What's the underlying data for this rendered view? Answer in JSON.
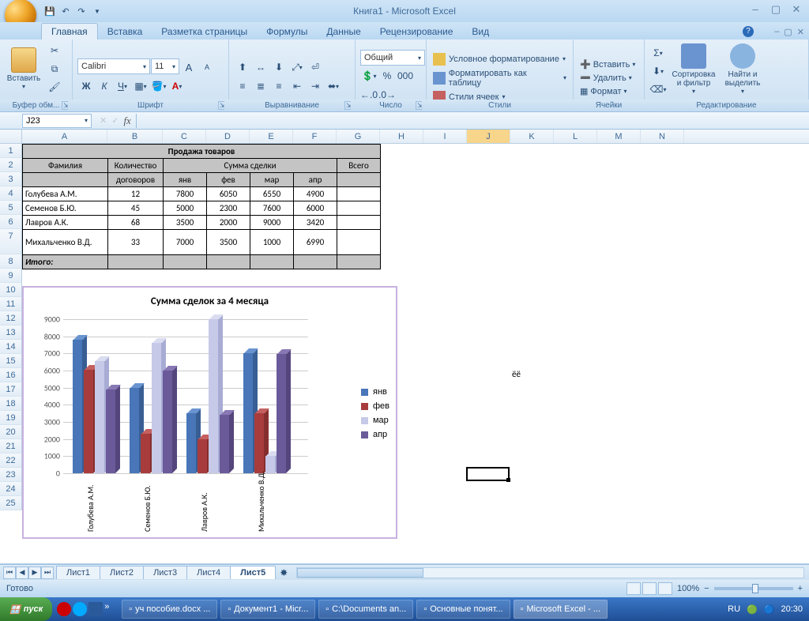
{
  "window": {
    "title": "Книга1 - Microsoft Excel"
  },
  "tabs": {
    "home": "Главная",
    "insert": "Вставка",
    "layout": "Разметка страницы",
    "formulas": "Формулы",
    "data": "Данные",
    "review": "Рецензирование",
    "view": "Вид"
  },
  "groups": {
    "clipboard": "Буфер обм...",
    "paste": "Вставить",
    "font": "Шрифт",
    "align": "Выравнивание",
    "number": "Число",
    "styles": "Стили",
    "cells": "Ячейки",
    "editing": "Редактирование"
  },
  "font": {
    "name": "Calibri",
    "size": "11"
  },
  "number": {
    "format": "Общий"
  },
  "styles_cmds": {
    "cond": "Условное форматирование",
    "table": "Форматировать как таблицу",
    "cell": "Стили ячеек"
  },
  "cells_cmds": {
    "insert": "Вставить",
    "delete": "Удалить",
    "format": "Формат"
  },
  "edit_cmds": {
    "sort": "Сортировка\nи фильтр",
    "find": "Найти и\nвыделить"
  },
  "namebox": "J23",
  "data_table": {
    "title": "Продажа товаров",
    "h_fam": "Фамилия",
    "h_cnt": "Количество договоров",
    "h_sum": "Сумма сделки",
    "h_tot": "Всего",
    "months": [
      "янв",
      "фев",
      "мар",
      "апр"
    ],
    "rows": [
      {
        "name": "Голубева А.М.",
        "cnt": "12",
        "v": [
          "7800",
          "6050",
          "6550",
          "4900"
        ]
      },
      {
        "name": "Семенов Б.Ю.",
        "cnt": "45",
        "v": [
          "5000",
          "2300",
          "7600",
          "6000"
        ]
      },
      {
        "name": "Лавров А.К.",
        "cnt": "68",
        "v": [
          "3500",
          "2000",
          "9000",
          "3420"
        ]
      },
      {
        "name": "Михальченко В.Д.",
        "cnt": "33",
        "v": [
          "7000",
          "3500",
          "1000",
          "6990"
        ]
      }
    ],
    "total": "Итого:"
  },
  "cell_k16": "ёё",
  "chart_data": {
    "type": "bar",
    "title": "Сумма сделок за 4 месяца",
    "categories": [
      "Голубева А.М.",
      "Семенов Б.Ю.",
      "Лавров А.К.",
      "Михальченко В.Д."
    ],
    "series": [
      {
        "name": "янв",
        "values": [
          7800,
          5000,
          3500,
          7000
        ],
        "color": "#4876b8"
      },
      {
        "name": "фев",
        "values": [
          6050,
          2300,
          2000,
          3500
        ],
        "color": "#a83c3c"
      },
      {
        "name": "мар",
        "values": [
          6550,
          7600,
          9000,
          1000
        ],
        "color": "#c6c9e8"
      },
      {
        "name": "апр",
        "values": [
          4900,
          6000,
          3420,
          6990
        ],
        "color": "#6a5a9a"
      }
    ],
    "ylim": [
      0,
      9000
    ],
    "yticks": [
      0,
      1000,
      2000,
      3000,
      4000,
      5000,
      6000,
      7000,
      8000,
      9000
    ]
  },
  "sheets": [
    "Лист1",
    "Лист2",
    "Лист3",
    "Лист4",
    "Лист5"
  ],
  "active_sheet": 4,
  "status": "Готово",
  "zoom": "100%",
  "taskbar": {
    "start": "пуск",
    "items": [
      "уч пособие.docx ...",
      "Документ1 - Micr...",
      "C:\\Documents an...",
      "Основные понят...",
      "Microsoft Excel - ..."
    ],
    "lang": "RU",
    "time": "20:30"
  }
}
